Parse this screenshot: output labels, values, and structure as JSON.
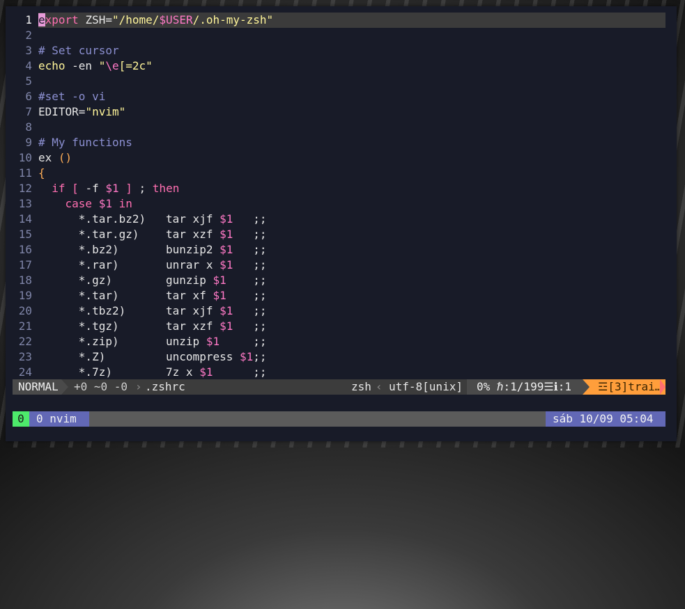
{
  "editor": {
    "lines": [
      {
        "n": "1",
        "current": true,
        "segs": [
          {
            "t": "e",
            "c": "cursor"
          },
          {
            "t": "xport",
            "c": "c-kw"
          },
          {
            "t": " ZSH=",
            "c": "c-plain"
          },
          {
            "t": "\"/home/",
            "c": "c-str"
          },
          {
            "t": "$USER",
            "c": "c-var"
          },
          {
            "t": "/.oh-my-zsh\"",
            "c": "c-str"
          }
        ]
      },
      {
        "n": "2",
        "segs": []
      },
      {
        "n": "3",
        "segs": [
          {
            "t": "# Set cursor",
            "c": "c-com"
          }
        ]
      },
      {
        "n": "4",
        "segs": [
          {
            "t": "echo",
            "c": "c-str"
          },
          {
            "t": " -en ",
            "c": "c-plain"
          },
          {
            "t": "\"",
            "c": "c-str"
          },
          {
            "t": "\\e",
            "c": "c-var"
          },
          {
            "t": "[=2c\"",
            "c": "c-str"
          }
        ]
      },
      {
        "n": "5",
        "segs": []
      },
      {
        "n": "6",
        "segs": [
          {
            "t": "#set -o vi",
            "c": "c-com"
          }
        ]
      },
      {
        "n": "7",
        "segs": [
          {
            "t": "EDITOR=",
            "c": "c-plain"
          },
          {
            "t": "\"nvim\"",
            "c": "c-str"
          }
        ]
      },
      {
        "n": "8",
        "segs": []
      },
      {
        "n": "9",
        "segs": [
          {
            "t": "# My functions",
            "c": "c-com"
          }
        ]
      },
      {
        "n": "10",
        "segs": [
          {
            "t": "ex ",
            "c": "c-plain"
          },
          {
            "t": "()",
            "c": "c-paren"
          }
        ]
      },
      {
        "n": "11",
        "segs": [
          {
            "t": "{",
            "c": "c-paren"
          }
        ]
      },
      {
        "n": "12",
        "segs": [
          {
            "t": "  ",
            "c": "c-plain"
          },
          {
            "t": "if",
            "c": "c-kw"
          },
          {
            "t": " ",
            "c": "c-plain"
          },
          {
            "t": "[",
            "c": "c-kw"
          },
          {
            "t": " -f ",
            "c": "c-plain"
          },
          {
            "t": "$1",
            "c": "c-var"
          },
          {
            "t": " ",
            "c": "c-plain"
          },
          {
            "t": "]",
            "c": "c-kw"
          },
          {
            "t": " ; ",
            "c": "c-plain"
          },
          {
            "t": "then",
            "c": "c-kw"
          }
        ]
      },
      {
        "n": "13",
        "segs": [
          {
            "t": "    ",
            "c": "c-plain"
          },
          {
            "t": "case",
            "c": "c-kw"
          },
          {
            "t": " ",
            "c": "c-plain"
          },
          {
            "t": "$1",
            "c": "c-var"
          },
          {
            "t": " ",
            "c": "c-plain"
          },
          {
            "t": "in",
            "c": "c-kw"
          }
        ]
      },
      {
        "n": "14",
        "segs": [
          {
            "t": "      *.tar.bz2)   tar xjf ",
            "c": "c-plain"
          },
          {
            "t": "$1",
            "c": "c-var"
          },
          {
            "t": "   ;;",
            "c": "c-plain"
          }
        ]
      },
      {
        "n": "15",
        "segs": [
          {
            "t": "      *.tar.gz)    tar xzf ",
            "c": "c-plain"
          },
          {
            "t": "$1",
            "c": "c-var"
          },
          {
            "t": "   ;;",
            "c": "c-plain"
          }
        ]
      },
      {
        "n": "16",
        "segs": [
          {
            "t": "      *.bz2)       bunzip2 ",
            "c": "c-plain"
          },
          {
            "t": "$1",
            "c": "c-var"
          },
          {
            "t": "   ;;",
            "c": "c-plain"
          }
        ]
      },
      {
        "n": "17",
        "segs": [
          {
            "t": "      *.rar)       unrar x ",
            "c": "c-plain"
          },
          {
            "t": "$1",
            "c": "c-var"
          },
          {
            "t": "   ;;",
            "c": "c-plain"
          }
        ]
      },
      {
        "n": "18",
        "segs": [
          {
            "t": "      *.gz)        gunzip ",
            "c": "c-plain"
          },
          {
            "t": "$1",
            "c": "c-var"
          },
          {
            "t": "    ;;",
            "c": "c-plain"
          }
        ]
      },
      {
        "n": "19",
        "segs": [
          {
            "t": "      *.tar)       tar xf ",
            "c": "c-plain"
          },
          {
            "t": "$1",
            "c": "c-var"
          },
          {
            "t": "    ;;",
            "c": "c-plain"
          }
        ]
      },
      {
        "n": "20",
        "segs": [
          {
            "t": "      *.tbz2)      tar xjf ",
            "c": "c-plain"
          },
          {
            "t": "$1",
            "c": "c-var"
          },
          {
            "t": "   ;;",
            "c": "c-plain"
          }
        ]
      },
      {
        "n": "21",
        "segs": [
          {
            "t": "      *.tgz)       tar xzf ",
            "c": "c-plain"
          },
          {
            "t": "$1",
            "c": "c-var"
          },
          {
            "t": "   ;;",
            "c": "c-plain"
          }
        ]
      },
      {
        "n": "22",
        "segs": [
          {
            "t": "      *.zip)       unzip ",
            "c": "c-plain"
          },
          {
            "t": "$1",
            "c": "c-var"
          },
          {
            "t": "     ;;",
            "c": "c-plain"
          }
        ]
      },
      {
        "n": "23",
        "segs": [
          {
            "t": "      *.Z)         uncompress ",
            "c": "c-plain"
          },
          {
            "t": "$1",
            "c": "c-var"
          },
          {
            "t": ";;",
            "c": "c-plain"
          }
        ]
      },
      {
        "n": "24",
        "segs": [
          {
            "t": "      *.7z)        7z x ",
            "c": "c-plain"
          },
          {
            "t": "$1",
            "c": "c-var"
          },
          {
            "t": "      ;;",
            "c": "c-plain"
          }
        ]
      }
    ]
  },
  "statusline": {
    "mode": "NORMAL",
    "git": "+0 ~0 -0",
    "filename": ".zshrc",
    "filetype": "zsh",
    "encoding": "utf-8[unix]",
    "position": "0% ℏ:1/199☰ℹ:1",
    "warning": "☲[3]trai…"
  },
  "tmux": {
    "session_index": "0",
    "window": "0 nvim",
    "clock": "sáb 10/09 05:04"
  },
  "colors": {
    "background": "#181b28",
    "accent_purple": "#6268b6",
    "accent_green": "#4dea6b",
    "warning_orange": "#ff9e3b"
  }
}
